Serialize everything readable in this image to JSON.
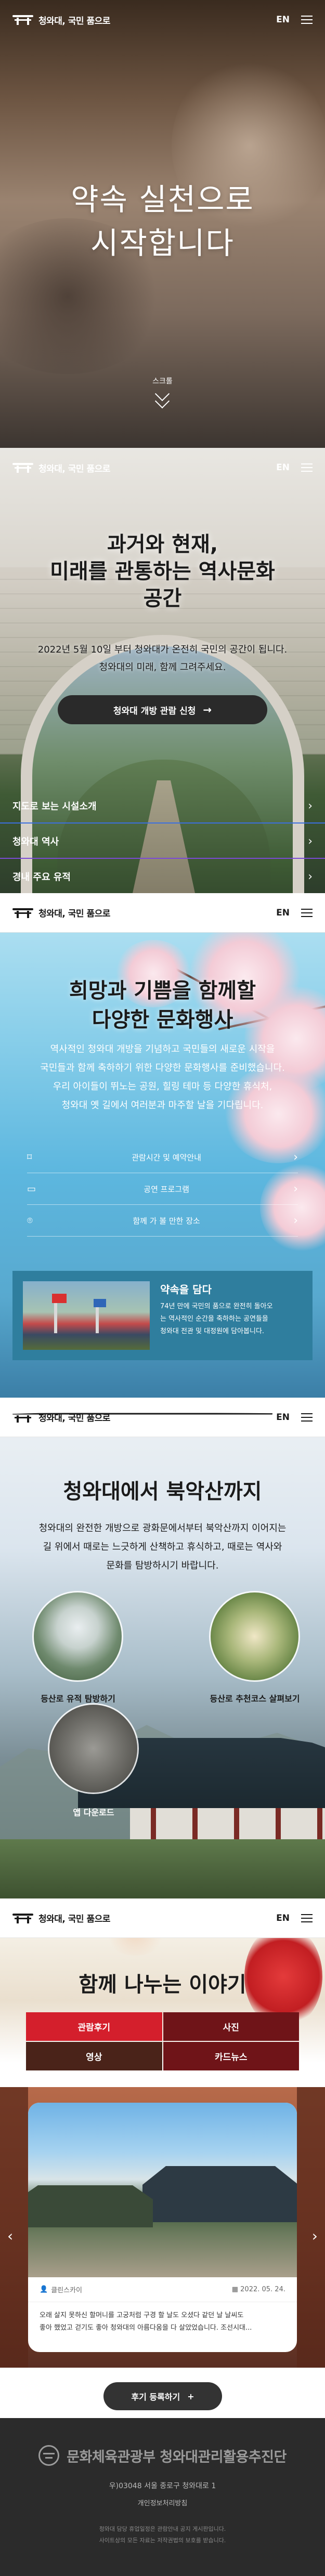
{
  "header": {
    "logo_text": "청와대, 국민 품으로",
    "lang": "EN"
  },
  "hero": {
    "title_line1": "약속 실천으로",
    "title_line2": "시작합니다",
    "scroll_label": "스크롤"
  },
  "history": {
    "title_line1": "과거와 현재,",
    "title_line2": "미래를 관통하는 역사문화",
    "title_line3": "공간",
    "desc_line1": "2022년 5월 10일 부터 청와대가 온전히 국민의 공간이 됩니다.",
    "desc_line2": "청와대의 미래, 함께 그려주세요.",
    "cta_label": "청와대 개방 관람 신청",
    "links": [
      "지도로 보는 시설소개",
      "청와대 역사",
      "경내 주요 유적"
    ]
  },
  "culture": {
    "title_line1": "희망과 기쁨을 함께할",
    "title_line2": "다양한 문화행사",
    "desc_line1": "역사적인 청와대 개방을 기념하고 국민들의 새로운 시작을",
    "desc_line2": "국민들과 함께 축하하기 위한 다양한 문화행사를 준비했습니다.",
    "desc_line3": "우리 아이들이 뛰노는 공원, 힐링 테마 등 다양한 휴식처,",
    "desc_line4": "청와대 옛 길에서 여러분과 마주할 날을 기다립니다.",
    "info_rows": [
      {
        "icon": "bookmark-icon",
        "label": "관람시간 및 예약안내"
      },
      {
        "icon": "monitor-icon",
        "label": "공연 프로그램"
      },
      {
        "icon": "location-pin-icon",
        "label": "함께 가 볼 만한 장소"
      }
    ],
    "card": {
      "title": "약속을 담다",
      "desc_line1": "74년 만에 국민의 품으로 완전히 돌아오",
      "desc_line2": "는 역사적인 순간을 축하하는 공연들을",
      "desc_line3": "청와대 전관 및 대정원에 담아봅니다."
    }
  },
  "bugak": {
    "title": "청와대에서 북악산까지",
    "desc_line1": "청와대의 완전한 개방으로 광화문에서부터 북악산까지 이어지는",
    "desc_line2": "길 위에서 때로는 느긋하게 산책하고 휴식하고, 때로는 역사와",
    "desc_line3": "문화를 탐방하시기 바랍니다.",
    "circles": [
      "등산로 유적 탐방하기",
      "등산로 추천코스 살펴보기",
      "앱 다운로드"
    ]
  },
  "story": {
    "title": "함께 나누는 이야기",
    "tabs": [
      "관람후기",
      "사진",
      "영상",
      "카드뉴스"
    ],
    "slide": {
      "user": "클린스카이",
      "date": "2022. 05. 24.",
      "text_line1": "오래 살지 못하신 할머니를 고궁처럼 구경 할 날도 오셨다 같던 날 날씨도",
      "text_line2": "좋아 했었고 걷기도 좋아 청와대의 아름다움을 다 살았었습니다. 조선시대..."
    },
    "more_label": "후기 등록하기"
  },
  "footer": {
    "logo_text": "문화체육관광부 청와대관리활용추진단",
    "address": "우)03048 서울 종로구 청와대로 1",
    "privacy": "개인정보처리방침",
    "notice_line1": "청와대 담당 휴업일정은 관람안내 공지 게시판입니다.",
    "notice_line2": "사이트상의 모든 자료는 저작권법의 보호를 받습니다."
  },
  "colors": {
    "accent_red": "#d41f2c",
    "dark_red": "#6f1418",
    "teal_card": "#2f7e9e",
    "footer_bg": "#2b2b2b"
  }
}
